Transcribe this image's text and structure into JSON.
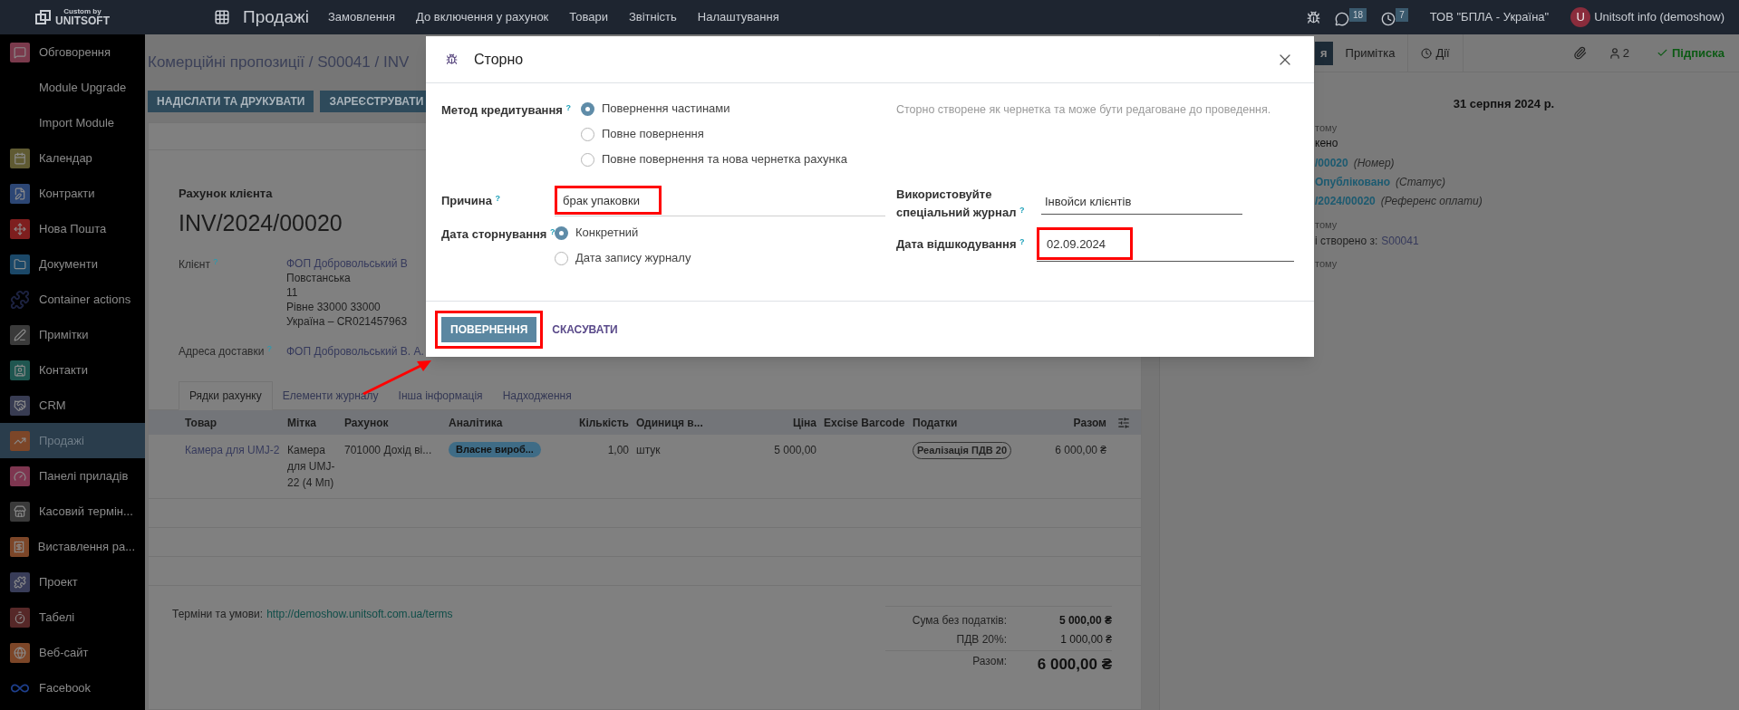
{
  "top_bar": {
    "logo_caption": "Custom by",
    "logo_name": "UNITSOFT",
    "app_title": "Продажі",
    "menu": [
      "Замовлення",
      "До включення у рахунок",
      "Товари",
      "Звітність",
      "Налаштування"
    ],
    "messages_count": "18",
    "activities_count": "7",
    "company": "ТОВ \"БПЛА - Україна\"",
    "user_initial": "U",
    "user_name": "Unitsoft info (demoshow)"
  },
  "sidebar": {
    "items": [
      {
        "label": "Обговорення",
        "kind": "tile",
        "color": "#7a3a4c",
        "selected": false
      },
      {
        "label": "Module Upgrade",
        "kind": "none",
        "selected": false
      },
      {
        "label": "Import Module",
        "kind": "none",
        "selected": false
      },
      {
        "label": "Календар",
        "kind": "tile",
        "color": "#5f5a32",
        "selected": false
      },
      {
        "label": "Контракти",
        "kind": "tile",
        "color": "#2c4674",
        "selected": false
      },
      {
        "label": "Нова Пошта",
        "kind": "tile",
        "color": "#7e1e1e",
        "selected": false
      },
      {
        "label": "Документи",
        "kind": "tile",
        "color": "#1b4868",
        "selected": false
      },
      {
        "label": "Container actions",
        "kind": "plain",
        "color": "#1c2240",
        "selected": false
      },
      {
        "label": "Примітки",
        "kind": "tile",
        "color": "#3a3a3a",
        "selected": false
      },
      {
        "label": "Контакти",
        "kind": "tile",
        "color": "#1f5650",
        "selected": false
      },
      {
        "label": "CRM",
        "kind": "tile",
        "color": "#383c52",
        "selected": false
      },
      {
        "label": "Продажі",
        "kind": "tile",
        "color": "#7c4628",
        "selected": true
      },
      {
        "label": "Панелі приладів",
        "kind": "tile",
        "color": "#7e3650",
        "selected": false
      },
      {
        "label": "Касовий термін...",
        "kind": "tile",
        "color": "#3a3a3a",
        "selected": false
      },
      {
        "label": "Виставлення ра...",
        "kind": "tile",
        "color": "#7c4628",
        "selected": false
      },
      {
        "label": "Проект",
        "kind": "tile",
        "color": "#383c58",
        "selected": false
      },
      {
        "label": "Табелі",
        "kind": "tile",
        "color": "#562828",
        "selected": false
      },
      {
        "label": "Веб-сайт",
        "kind": "tile",
        "color": "#7c4628",
        "selected": false
      },
      {
        "label": "Facebook",
        "kind": "plain",
        "color": "#1e3f8c",
        "selected": false
      }
    ]
  },
  "control_panel": {
    "breadcrumb": "Комерційні пропозиції / S00041 / INV",
    "buttons": [
      "НАДІСЛАТИ ТА ДРУКУВАТИ",
      "ЗАРЕЄСТРУВАТИ"
    ]
  },
  "invoice": {
    "type_label": "Рахунок клієнта",
    "number": "INV/2024/00020",
    "customer_label": "Клієнт $^{?}$",
    "customer_name": "ФОП Добровольський В",
    "customer_address": [
      "Повстанська",
      "11",
      "Рівне 33000 33000",
      "Україна – CR021457963"
    ],
    "delivery_label": "Адреса доставки $^{?}$",
    "delivery_value": "ФОП Добровольський В. А.",
    "tabs": [
      {
        "label": "Рядки рахунку",
        "selected": true
      },
      {
        "label": "Елементи журналу",
        "selected": false
      },
      {
        "label": "Інша інформація",
        "selected": false
      },
      {
        "label": "Надходження",
        "selected": false
      }
    ],
    "columns": [
      {
        "label": "Товар",
        "kind": "text"
      },
      {
        "label": "Мітка",
        "kind": "text"
      },
      {
        "label": "Рахунок",
        "kind": "text"
      },
      {
        "label": "Аналітика",
        "kind": "text"
      },
      {
        "label": "Кількість",
        "kind": "number"
      },
      {
        "label": "Одиниця в...",
        "kind": "text"
      },
      {
        "label": "Ціна",
        "kind": "number"
      },
      {
        "label": "Excise Barcode",
        "kind": "text"
      },
      {
        "label": "Податки",
        "kind": "text"
      },
      {
        "label": "Разом",
        "kind": "number"
      }
    ],
    "rows": [
      {
        "product": "Камера для UMJ-2",
        "label": "Камера для UMJ-22 (4 Мп)",
        "account": "701000 Дохід ві...",
        "analytic": "Власне вироб...",
        "quantity": "1,00",
        "uom": "штук",
        "price": "5 000,00",
        "taxes": "Реалізація ПДВ 20",
        "total": "6 000,00 ₴"
      }
    ],
    "terms_label": "Терміни та умови:",
    "terms_link": "http://demoshow.unitsoft.com.ua/terms",
    "totals": [
      {
        "label": "Сума без податків:",
        "value": "5 000,00 ₴",
        "kind": "subtotal"
      },
      {
        "label": "ПДВ 20%:",
        "value": "1 000,00 ₴",
        "kind": "tax"
      },
      {
        "label": "Разом:",
        "value": "6 000,00 ₴",
        "kind": "total"
      }
    ]
  },
  "chatter": {
    "send_fragment": "я",
    "note_tab": "Примітка",
    "activities_tab": "Дії",
    "followers_count": "2",
    "follow_label": "Підписка",
    "date": "31 серпня 2024 р.",
    "messages": [
      {
        "time": "тому",
        "lines": [
          {
            "kind": "text",
            "text": "кено"
          },
          {
            "kind": "change",
            "value": "/00020",
            "field": "(Номер)"
          },
          {
            "kind": "change",
            "value": "Опубліковано",
            "field": "(Статус)"
          },
          {
            "kind": "change",
            "value": "/2024/00020",
            "field": "(Референс оплати)"
          }
        ]
      },
      {
        "time": "тому",
        "lines": [
          {
            "kind": "link",
            "text": "і створено з:",
            "link": "S00041"
          }
        ]
      },
      {
        "time": "тому"
      }
    ]
  },
  "dialog": {
    "title": "Сторно",
    "method_label": "Метод кредитування $^{?}$",
    "method_options": [
      {
        "label": "Повернення частинами",
        "selected": true
      },
      {
        "label": "Повне повернення",
        "selected": false
      },
      {
        "label": "Повне повернення та нова чернетка рахунка",
        "selected": false
      }
    ],
    "note": "Сторно створене як чернетка та може бути редаговане до проведення.",
    "reason_label": "Причина $^{?}$",
    "reason_value": "брак упаковки",
    "date_mode_label": "Дата сторнування $^{?}$",
    "date_mode_options": [
      {
        "label": "Конкретний",
        "selected": true
      },
      {
        "label": "Дата запису журналу",
        "selected": false
      }
    ],
    "journal_label": "Використовуйте спеціальний журнал $^{?}$",
    "journal_value": "Інвойси клієнтів",
    "refund_date_label": "Дата відшкодування $^{?}$",
    "refund_date_value": "02.09.2024",
    "confirm_button": "ПОВЕРНЕННЯ",
    "cancel_button": "СКАСУВАТИ"
  }
}
